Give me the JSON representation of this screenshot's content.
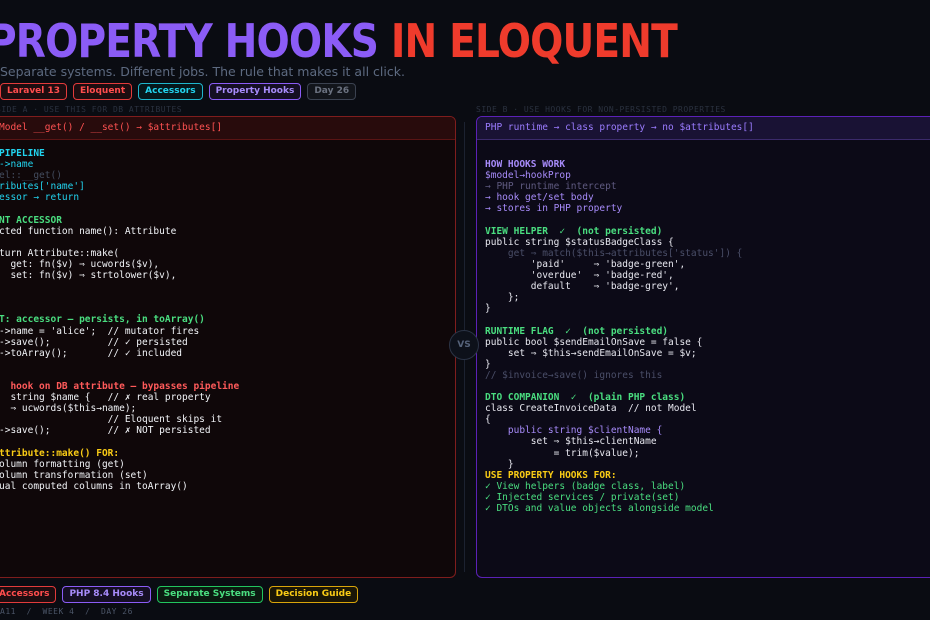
{
  "title": {
    "part1": "PROPERTY HOOKS",
    "part2": "IN ELOQUENT"
  },
  "subtitle": "Separate systems. Different jobs. The rule that makes it all click.",
  "tags": [
    "Laravel 13",
    "Eloquent",
    "Accessors",
    "Property Hooks",
    "Day 26"
  ],
  "left_label": "SIDE A · USE THIS FOR DB ATTRIBUTES",
  "right_label": "SIDE B · USE HOOKS FOR NON-PERSISTED PROPERTIES",
  "left_header": "Model  __get() / __set()  →  $attributes[]",
  "right_header": "PHP runtime  →  class property  →  no $attributes[]",
  "left_lines": [
    {
      "t": "PIPELINE",
      "c": "c-cyan b"
    },
    {
      "t": "->name",
      "c": "c-cyan"
    },
    {
      "t": "el::__get()",
      "c": "c-dim"
    },
    {
      "t": "ributes['name']",
      "c": "c-cyan"
    },
    {
      "t": "essor → return",
      "c": "c-cyan"
    },
    {
      "t": "",
      "c": ""
    },
    {
      "t": "NT ACCESSOR  ",
      "c": "c-green b"
    },
    {
      "t": "cted function name(): Attribute",
      "c": "c-bright"
    },
    {
      "t": "",
      "c": ""
    },
    {
      "t": "turn Attribute::make(",
      "c": "c-bright"
    },
    {
      "t": "  get: fn($v) ⇒ ucwords($v),",
      "c": "c-bright"
    },
    {
      "t": "  set: fn($v) ⇒ strtolower($v),",
      "c": "c-bright"
    },
    {
      "t": "",
      "c": ""
    },
    {
      "t": "",
      "c": ""
    },
    {
      "t": "",
      "c": ""
    },
    {
      "t": "T: accessor — persists, in toArray()",
      "c": "c-green b"
    },
    {
      "t": "->name = 'alice';  // mutator fires",
      "c": "c-bright"
    },
    {
      "t": "->save();          // ✓ persisted",
      "c": "c-bright"
    },
    {
      "t": "->toArray();       // ✓ included",
      "c": "c-bright"
    },
    {
      "t": "",
      "c": ""
    },
    {
      "t": "",
      "c": ""
    },
    {
      "t": "  hook on DB attribute — bypasses pipeline",
      "c": "c-red b"
    },
    {
      "t": "  string $name {   // ✗ real property",
      "c": "c-bright"
    },
    {
      "t": "  ⇒ ucwords($this→name);",
      "c": "c-bright"
    },
    {
      "t": "                   // Eloquent skips it",
      "c": "c-bright"
    },
    {
      "t": "->save();          // ✗ NOT persisted",
      "c": "c-bright"
    },
    {
      "t": "",
      "c": ""
    },
    {
      "t": "ttribute::make() FOR:",
      "c": "c-yellow b"
    },
    {
      "t": "olumn formatting (get)",
      "c": "c-bright"
    },
    {
      "t": "olumn transformation (set)",
      "c": "c-bright"
    },
    {
      "t": "ual computed columns in toArray()",
      "c": "c-bright"
    }
  ],
  "right_lines": [
    {
      "t": "",
      "c": ""
    },
    {
      "t": "HOW HOOKS WORK",
      "c": "c-purple b"
    },
    {
      "t": "$model→hookProp",
      "c": "c-purple"
    },
    {
      "t": "→ PHP runtime intercept",
      "c": "c-grayp"
    },
    {
      "t": "→ hook get/set body",
      "c": "c-purple"
    },
    {
      "t": "→ stores in PHP property",
      "c": "c-purple"
    },
    {
      "t": "",
      "c": ""
    },
    {
      "t": "VIEW HELPER  ✓  (not persisted)",
      "c": "c-green b"
    },
    {
      "t": "public string $statusBadgeClass {",
      "c": "c-white"
    },
    {
      "t": "    get ⇒ match($this→attributes['status']) {",
      "c": "c-dimline"
    },
    {
      "t": "        'paid'     ⇒ 'badge-green',",
      "c": "c-white"
    },
    {
      "t": "        'overdue'  ⇒ 'badge-red',",
      "c": "c-white"
    },
    {
      "t": "        default    ⇒ 'badge-grey',",
      "c": "c-white"
    },
    {
      "t": "    };",
      "c": "c-white"
    },
    {
      "t": "}",
      "c": "c-white"
    },
    {
      "t": "",
      "c": ""
    },
    {
      "t": "RUNTIME FLAG  ✓  (not persisted)",
      "c": "c-green b"
    },
    {
      "t": "public bool $sendEmailOnSave = false {",
      "c": "c-white"
    },
    {
      "t": "    set ⇒ $this→sendEmailOnSave = $v;",
      "c": "c-white"
    },
    {
      "t": "}",
      "c": "c-white"
    },
    {
      "t": "// $invoice→save() ignores this",
      "c": "c-dimline"
    },
    {
      "t": "",
      "c": ""
    },
    {
      "t": "DTO COMPANION  ✓  (plain PHP class)",
      "c": "c-green b"
    },
    {
      "t": "class CreateInvoiceData  // not Model",
      "c": "c-white"
    },
    {
      "t": "{",
      "c": "c-white"
    },
    {
      "t": "    public string $clientName {",
      "c": "c-purple"
    },
    {
      "t": "        set ⇒ $this→clientName",
      "c": "c-white"
    },
    {
      "t": "            = trim($value);",
      "c": "c-white"
    },
    {
      "t": "    }",
      "c": "c-white"
    },
    {
      "t": "USE PROPERTY HOOKS FOR:",
      "c": "c-yellow b"
    },
    {
      "t": "✓ View helpers (badge class, label)",
      "c": "c-green"
    },
    {
      "t": "✓ Injected services / private(set)",
      "c": "c-green"
    },
    {
      "t": "✓ DTOs and value objects alongside model",
      "c": "c-green"
    }
  ],
  "vs_label": "VS",
  "bottom_tags": [
    "Accessors",
    "PHP 8.4 Hooks",
    "Separate Systems",
    "Decision Guide"
  ],
  "footer": "A11  /  WEEK 4  /  DAY 26",
  "colors": {
    "purple": "#8b5cf6",
    "red": "#ef3b2c",
    "cyan": "#22d3ee",
    "green": "#4ade80",
    "yellow": "#facc15",
    "background": "#0a0c12"
  }
}
